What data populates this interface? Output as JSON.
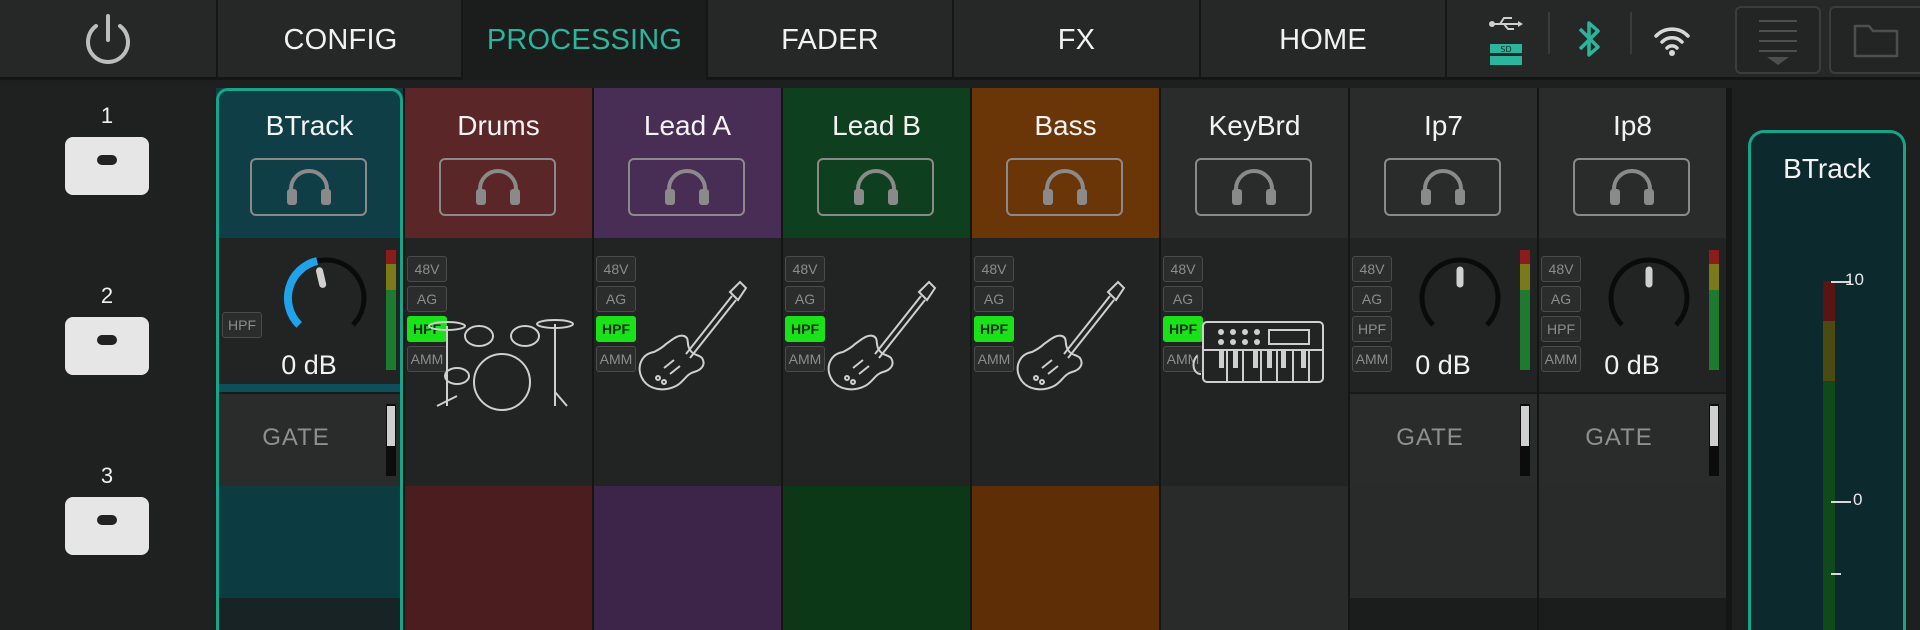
{
  "topbar": {
    "power_icon": "power-icon",
    "tabs": [
      {
        "label": "CONFIG",
        "active": false
      },
      {
        "label": "PROCESSING",
        "active": true
      },
      {
        "label": "FADER",
        "active": false
      },
      {
        "label": "FX",
        "active": false
      },
      {
        "label": "HOME",
        "active": false
      }
    ],
    "status_icons": [
      "usb-sd-icon",
      "bluetooth-icon",
      "wifi-icon"
    ],
    "buttons": [
      "menu-dropdown-icon",
      "folder-icon"
    ]
  },
  "scenes": [
    {
      "label": "1"
    },
    {
      "label": "2"
    },
    {
      "label": "3"
    }
  ],
  "channels": [
    {
      "name": "BTrack",
      "color": "#0f3e47",
      "bottom_color": "#0d3b42",
      "selected": true,
      "type": "input",
      "pills": [
        "HPF"
      ],
      "hpf_on": false,
      "gain": "0 dB",
      "gate": "GATE",
      "knob_level": 0.45,
      "meter_level": 0.95
    },
    {
      "name": "Drums",
      "color": "#5a2628",
      "bottom_color": "#4c1d1f",
      "selected": false,
      "type": "instrument",
      "instrument": "drums",
      "pills": [
        "48V",
        "AG",
        "HPF",
        "AMM"
      ],
      "hpf_on": true
    },
    {
      "name": "Lead A",
      "color": "#482d55",
      "bottom_color": "#3c2548",
      "selected": false,
      "type": "instrument",
      "instrument": "guitar",
      "pills": [
        "48V",
        "AG",
        "HPF",
        "AMM"
      ],
      "hpf_on": true
    },
    {
      "name": "Lead B",
      "color": "#0e3f1f",
      "bottom_color": "#0c3818",
      "selected": false,
      "type": "instrument",
      "instrument": "guitar",
      "pills": [
        "48V",
        "AG",
        "HPF",
        "AMM"
      ],
      "hpf_on": true
    },
    {
      "name": "Bass",
      "color": "#6a3507",
      "bottom_color": "#5e2f06",
      "selected": false,
      "type": "instrument",
      "instrument": "guitar",
      "pills": [
        "48V",
        "AG",
        "HPF",
        "AMM"
      ],
      "hpf_on": true
    },
    {
      "name": "KeyBrd",
      "color": "#2a2c2c",
      "bottom_color": "#292a2a",
      "selected": false,
      "type": "instrument",
      "instrument": "keyboard",
      "pills": [
        "48V",
        "AG",
        "HPF",
        "AMM"
      ],
      "hpf_on": true
    },
    {
      "name": "Ip7",
      "color": "#2a2c2c",
      "bottom_color": "#292a2a",
      "selected": false,
      "type": "input",
      "pills": [
        "48V",
        "AG",
        "HPF",
        "AMM"
      ],
      "hpf_on": false,
      "gain": "0 dB",
      "gate": "GATE",
      "knob_level": 0.5,
      "meter_level": 0.95
    },
    {
      "name": "Ip8",
      "color": "#2a2c2c",
      "bottom_color": "#292a2a",
      "selected": false,
      "type": "input",
      "pills": [
        "48V",
        "AG",
        "HPF",
        "AMM"
      ],
      "hpf_on": false,
      "gain": "0 dB",
      "gate": "GATE",
      "knob_level": 0.5,
      "meter_level": 0.95
    }
  ],
  "master": {
    "name": "BTrack",
    "scale": [
      {
        "label": "10",
        "value": 10
      },
      {
        "label": "0",
        "value": 0
      }
    ],
    "accent": "#17a58a"
  }
}
